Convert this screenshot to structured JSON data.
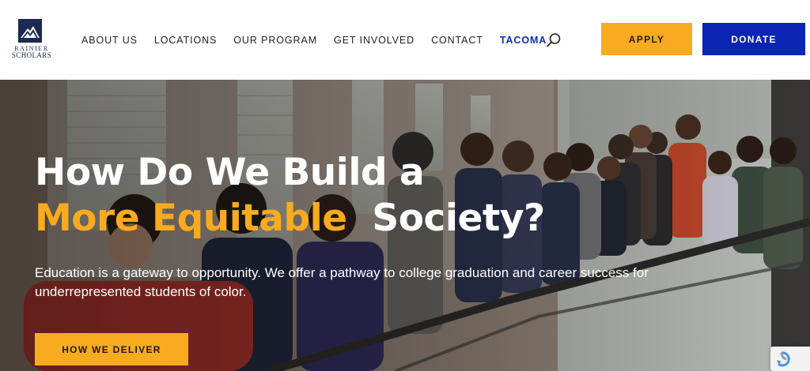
{
  "brand": {
    "line1": "RAINIER",
    "line2": "SCHOLARS",
    "colors": {
      "navy": "#1b2a55",
      "accent": "#f9ab1f",
      "blue": "#0b25b3"
    }
  },
  "nav": {
    "items": [
      {
        "label": "ABOUT US",
        "active": false
      },
      {
        "label": "LOCATIONS",
        "active": false
      },
      {
        "label": "OUR PROGRAM",
        "active": false
      },
      {
        "label": "GET INVOLVED",
        "active": false
      },
      {
        "label": "CONTACT",
        "active": false
      },
      {
        "label": "TACOMA",
        "active": true
      }
    ],
    "search_icon": "search-icon"
  },
  "cta": {
    "apply": "APPLY",
    "donate": "DONATE"
  },
  "hero": {
    "title_line1": "How Do We Build a",
    "title_accent": "More Equitable",
    "title_end": "Society?",
    "body": "Education is a gateway to opportunity. We offer a pathway to college graduation and career success for underrepresented students of color.",
    "button": "HOW WE DELIVER",
    "photo": "group-of-students-photo"
  },
  "recaptcha": {
    "icon": "recaptcha-icon"
  }
}
